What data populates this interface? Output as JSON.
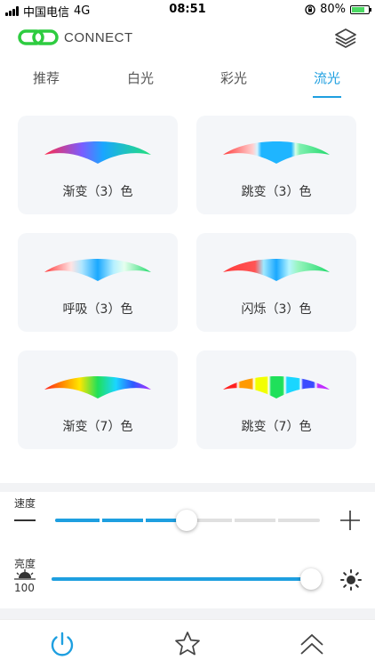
{
  "status_bar": {
    "carrier": "中国电信",
    "network": "4G",
    "time": "08:51",
    "battery": "80%",
    "battery_level": 0.8
  },
  "header": {
    "logo_text": "CONNECT",
    "logo_color": "#2ecc40"
  },
  "tabs": [
    {
      "label": "推荐",
      "active": false
    },
    {
      "label": "白光",
      "active": false
    },
    {
      "label": "彩光",
      "active": false
    },
    {
      "label": "流光",
      "active": true
    }
  ],
  "effects": [
    {
      "label": "渐变（3）色",
      "preview": "gradient-3"
    },
    {
      "label": "跳变（3）色",
      "preview": "jump-3"
    },
    {
      "label": "呼吸（3）色",
      "preview": "breath-3"
    },
    {
      "label": "闪烁（3）色",
      "preview": "flash-3"
    },
    {
      "label": "渐变（7）色",
      "preview": "gradient-7"
    },
    {
      "label": "跳变（7）色",
      "preview": "jump-7"
    }
  ],
  "speed": {
    "label": "速度",
    "level": 0.6,
    "segments": 6
  },
  "brightness": {
    "label": "亮度",
    "value": "100",
    "level": 1.0
  },
  "accent_color": "#1e9fe0"
}
